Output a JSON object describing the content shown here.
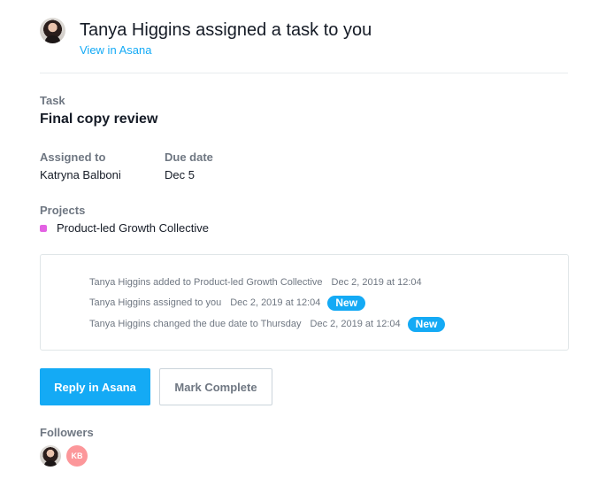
{
  "header": {
    "title": "Tanya Higgins assigned a task to you",
    "link_label": "View in Asana",
    "avatar_icon": "user-photo-tanya-higgins"
  },
  "task": {
    "label": "Task",
    "title": "Final copy review"
  },
  "assigned": {
    "label": "Assigned to",
    "value": "Katryna Balboni"
  },
  "due": {
    "label": "Due date",
    "value": "Dec 5"
  },
  "projects": {
    "label": "Projects",
    "items": [
      {
        "name": "Product-led Growth Collective",
        "color": "#e362e3"
      }
    ]
  },
  "activity": [
    {
      "text": "Tanya Higgins added to Product-led Growth Collective",
      "date": "Dec 2, 2019 at 12:04",
      "badge": ""
    },
    {
      "text": "Tanya Higgins assigned to you",
      "date": "Dec 2, 2019 at 12:04",
      "badge": "New"
    },
    {
      "text": "Tanya Higgins changed the due date to Thursday",
      "date": "Dec 2, 2019 at 12:04",
      "badge": "New"
    }
  ],
  "actions": {
    "reply_label": "Reply in Asana",
    "complete_label": "Mark Complete"
  },
  "followers": {
    "label": "Followers",
    "items": [
      {
        "type": "photo",
        "icon": "user-photo-tanya-higgins"
      },
      {
        "type": "initials",
        "initials": "KB",
        "color": "#fc979a"
      }
    ]
  },
  "colors": {
    "accent": "#14aaf5",
    "text": "#151b26",
    "muted": "#6f7782"
  }
}
